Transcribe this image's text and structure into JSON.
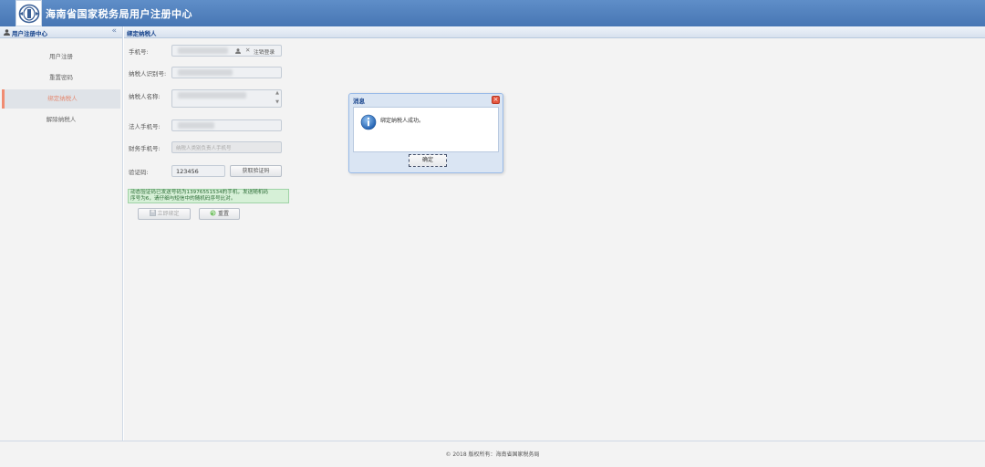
{
  "header": {
    "title": "海南省国家税务局用户注册中心"
  },
  "sidebar": {
    "title": "用户注册中心",
    "collapse_icon": "«",
    "items": [
      {
        "label": "用户注册"
      },
      {
        "label": "重置密码"
      },
      {
        "label": "绑定纳税人",
        "active": true
      },
      {
        "label": "解除纳税人"
      }
    ]
  },
  "main": {
    "title": "绑定纳税人",
    "form": {
      "phone_label": "手机号:",
      "logout_label": "注销登录",
      "taxpayer_id_label": "纳税人识别号:",
      "taxpayer_name_label": "纳税人名称:",
      "legal_phone_label": "法人手机号:",
      "finance_phone_label": "财务手机号:",
      "finance_phone_placeholder": "纳税人类别负责人手机号",
      "code_label": "验证码:",
      "code_value": "123456",
      "get_code_label": "获取验证码"
    },
    "notice": {
      "line1": "动态验证码已发送号码为13976551534的手机，发送随机码",
      "line2": "序号为6，请仔细与短信中的随机码序号比对。"
    },
    "buttons": {
      "bind_label": "立即绑定",
      "reset_label": "重置"
    }
  },
  "dialog": {
    "title": "消息",
    "message": "绑定纳税人成功。",
    "ok_label": "确定"
  },
  "footer": {
    "text": "© 2018 版权所有：海南省国家税务局"
  },
  "colors": {
    "header": "#4f7fbd",
    "active_accent": "#f08c72",
    "notice_bg": "#d6f0d7",
    "dialog_close": "#e6563e"
  }
}
